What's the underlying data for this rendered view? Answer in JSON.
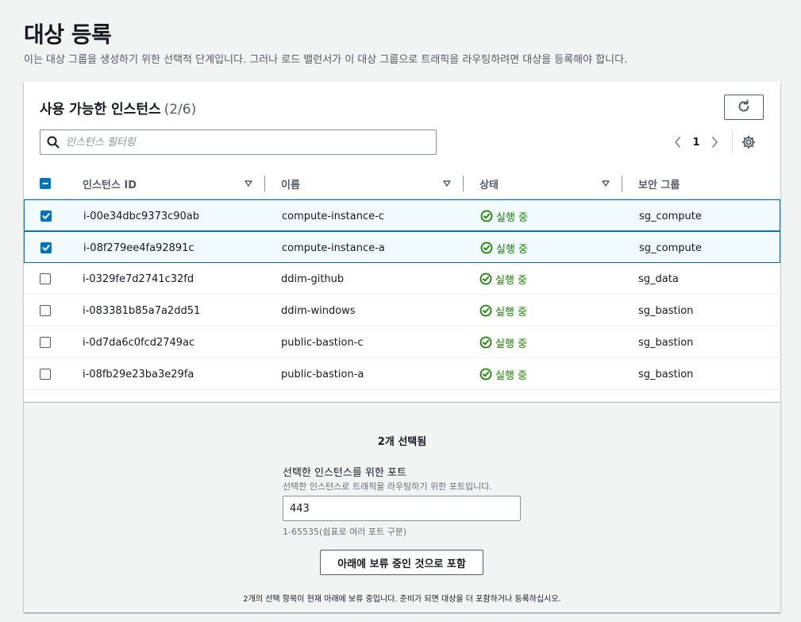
{
  "page": {
    "title": "대상 등록",
    "description": "이는 대상 그룹을 생성하기 위한 선택적 단계입니다. 그러나 로드 밸런서가 이 대상 그룹으로 트래픽을 라우팅하려면 대상을 등록해야 합니다."
  },
  "panel": {
    "title": "사용 가능한 인스턴스",
    "count": "(2/6)",
    "refresh_icon": "refresh-icon",
    "search_placeholder": "인스턴스 필터링",
    "search_value": "",
    "page_number": "1"
  },
  "table": {
    "columns": [
      "인스턴스 ID",
      "이름",
      "상태",
      "보안 그룹"
    ],
    "rows": [
      {
        "selected": true,
        "id": "i-00e34dbc9373c90ab",
        "name": "compute-instance-c",
        "status": "실행 중",
        "sg": "sg_compute"
      },
      {
        "selected": true,
        "id": "i-08f279ee4fa92891c",
        "name": "compute-instance-a",
        "status": "실행 중",
        "sg": "sg_compute"
      },
      {
        "selected": false,
        "id": "i-0329fe7d2741c32fd",
        "name": "ddim-github",
        "status": "실행 중",
        "sg": "sg_data"
      },
      {
        "selected": false,
        "id": "i-083381b85a7a2dd51",
        "name": "ddim-windows",
        "status": "실행 중",
        "sg": "sg_bastion"
      },
      {
        "selected": false,
        "id": "i-0d7da6c0fcd2749ac",
        "name": "public-bastion-c",
        "status": "실행 중",
        "sg": "sg_bastion"
      },
      {
        "selected": false,
        "id": "i-08fb29e23ba3e29fa",
        "name": "public-bastion-a",
        "status": "실행 중",
        "sg": "sg_bastion"
      }
    ]
  },
  "footer": {
    "selected_count": "2개 선택됨",
    "port_label": "선택한 인스턴스를 위한 포트",
    "port_hint": "선택한 인스턴스로 트래픽을 라우팅하기 위한 포트입니다.",
    "port_value": "443",
    "port_range": "1-65535(쉼표로 여러 포트 구분)",
    "include_button": "아래에 보류 중인 것으로 포함",
    "note": "2개의 선택 항목이 현재 아래에 보류 중입니다. 준비가 되면 대상을 더 포함하거나 등록하십시오."
  },
  "colors": {
    "accent": "#0073bb",
    "status_ok": "#1d8102",
    "selected_row": "#f1faff"
  }
}
